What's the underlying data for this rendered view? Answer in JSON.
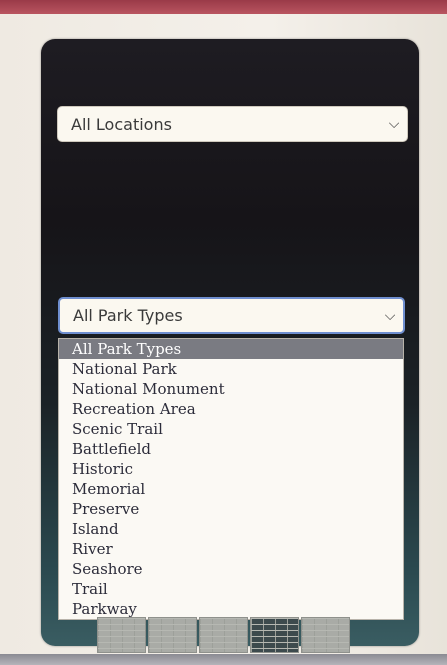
{
  "locations_select": {
    "value": "All Locations"
  },
  "types_select": {
    "value": "All Park Types"
  },
  "type_options": [
    "All Park Types",
    "National Park",
    "National Monument",
    "Recreation Area",
    "Scenic Trail",
    "Battlefield",
    "Historic",
    "Memorial",
    "Preserve",
    "Island",
    "River",
    "Seashore",
    "Trail",
    "Parkway"
  ],
  "selected_option_index": 0,
  "icons": {
    "dropdown": "chevron-down-icon"
  },
  "colors": {
    "focus_border": "#6f8fd0",
    "highlight": "#7a7b82"
  }
}
